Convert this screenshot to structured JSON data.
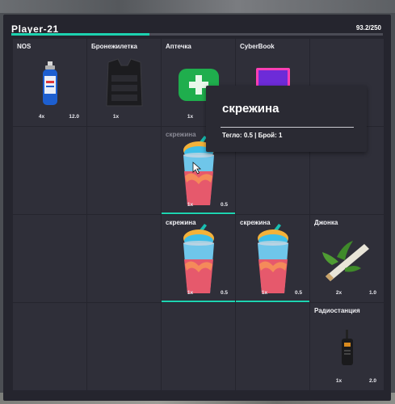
{
  "header": {
    "player_name": "Player-21",
    "weight": "93.2/250",
    "weight_fraction": 0.372
  },
  "slots": [
    {
      "label": "NOS",
      "qty": "4x",
      "weight": "12.0",
      "icon": "nos-bottle-icon",
      "underline": false
    },
    {
      "label": "Бронежилетка",
      "qty": "1x",
      "weight": "",
      "icon": "vest-icon",
      "underline": false
    },
    {
      "label": "Аптечка",
      "qty": "1x",
      "weight": "",
      "icon": "medkit-icon",
      "underline": false
    },
    {
      "label": "CyberBook",
      "qty": "",
      "weight": "",
      "icon": "laptop-icon",
      "underline": false
    },
    {
      "label": "",
      "qty": "",
      "weight": "",
      "icon": "",
      "underline": false
    },
    {
      "label": "",
      "qty": "",
      "weight": "",
      "icon": "",
      "underline": false
    },
    {
      "label": "",
      "qty": "",
      "weight": "",
      "icon": "",
      "underline": false
    },
    {
      "label": "скрежина",
      "qty": "1x",
      "weight": "0.5",
      "icon": "slush-drink-icon",
      "underline": true,
      "dim": true
    },
    {
      "label": "",
      "qty": "",
      "weight": "",
      "icon": "",
      "underline": false
    },
    {
      "label": "",
      "qty": "",
      "weight": "",
      "icon": "",
      "underline": false
    },
    {
      "label": "",
      "qty": "",
      "weight": "",
      "icon": "",
      "underline": false
    },
    {
      "label": "",
      "qty": "",
      "weight": "",
      "icon": "",
      "underline": false
    },
    {
      "label": "скрежина",
      "qty": "1x",
      "weight": "0.5",
      "icon": "slush-drink-icon",
      "underline": true
    },
    {
      "label": "скрежина",
      "qty": "1x",
      "weight": "0.5",
      "icon": "slush-drink-icon",
      "underline": true
    },
    {
      "label": "Джонка",
      "qty": "2x",
      "weight": "1.0",
      "icon": "joint-icon",
      "underline": false
    },
    {
      "label": "",
      "qty": "",
      "weight": "",
      "icon": "",
      "underline": false
    },
    {
      "label": "",
      "qty": "",
      "weight": "",
      "icon": "",
      "underline": false
    },
    {
      "label": "",
      "qty": "",
      "weight": "",
      "icon": "",
      "underline": false
    },
    {
      "label": "",
      "qty": "",
      "weight": "",
      "icon": "",
      "underline": false
    },
    {
      "label": "Радиостанция",
      "qty": "1x",
      "weight": "2.0",
      "icon": "radio-icon",
      "underline": false
    }
  ],
  "tooltip": {
    "title": "скрежина",
    "stats": "Тегло: 0.5 | Брой: 1"
  },
  "colors": {
    "accent": "#1dd3b0",
    "panel": "#25252e",
    "slot": "#2f2f39"
  }
}
